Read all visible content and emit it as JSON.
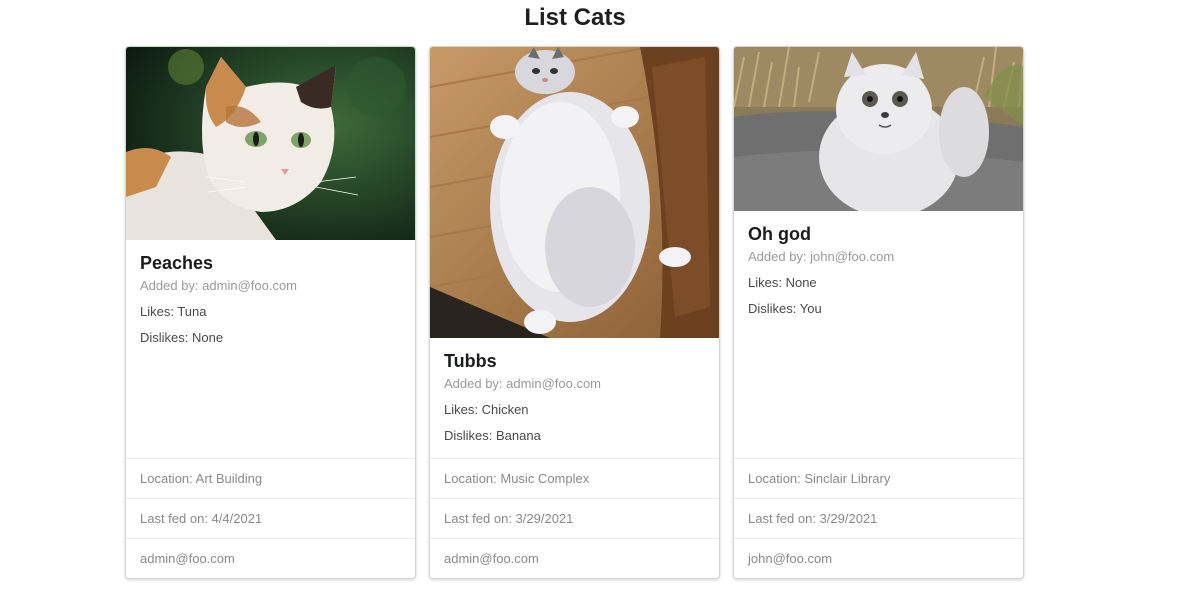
{
  "page": {
    "title": "List Cats"
  },
  "cats": [
    {
      "name": "Peaches",
      "added_by": "Added by: admin@foo.com",
      "likes": "Likes: Tuna",
      "dislikes": "Dislikes: None",
      "location": "Location: Art Building",
      "last_fed": "Last fed on: 4/4/2021",
      "owner": "admin@foo.com",
      "image_desc": "calico-cat-photo"
    },
    {
      "name": "Tubbs",
      "added_by": "Added by: admin@foo.com",
      "likes": "Likes: Chicken",
      "dislikes": "Dislikes: Banana",
      "location": "Location: Music Complex",
      "last_fed": "Last fed on: 3/29/2021",
      "owner": "admin@foo.com",
      "image_desc": "fluffy-gray-cat-photo"
    },
    {
      "name": "Oh god",
      "added_by": "Added by: john@foo.com",
      "likes": "Likes: None",
      "dislikes": "Dislikes: You",
      "location": "Location: Sinclair Library",
      "last_fed": "Last fed on: 3/29/2021",
      "owner": "john@foo.com",
      "image_desc": "white-persian-cat-photo"
    }
  ]
}
